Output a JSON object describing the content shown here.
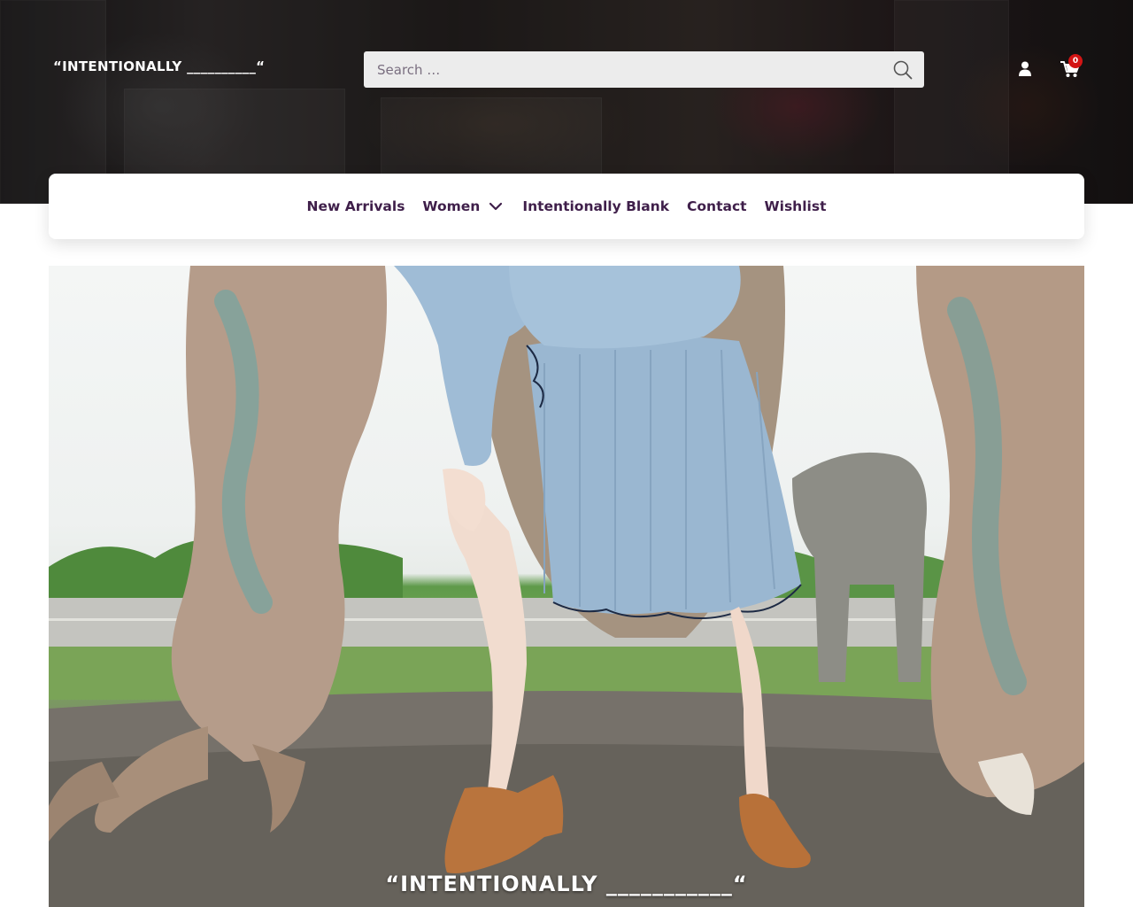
{
  "header": {
    "logo_text": "“INTENTIONALLY __________“",
    "search_placeholder": "Search …",
    "cart_count": "0",
    "icons": {
      "search": "search-icon",
      "user": "user-icon",
      "cart": "cart-icon"
    },
    "colors": {
      "badge": "#d31515",
      "search_bg": "#ececec"
    }
  },
  "nav": {
    "items": [
      {
        "label": "New Arrivals"
      },
      {
        "label": "Women",
        "has_dropdown": true
      },
      {
        "label": "Intentionally Blank"
      },
      {
        "label": "Contact"
      },
      {
        "label": "Wishlist"
      }
    ],
    "color": "#3f1f4a"
  },
  "hero": {
    "caption": "“INTENTIONALLY ___________“"
  }
}
